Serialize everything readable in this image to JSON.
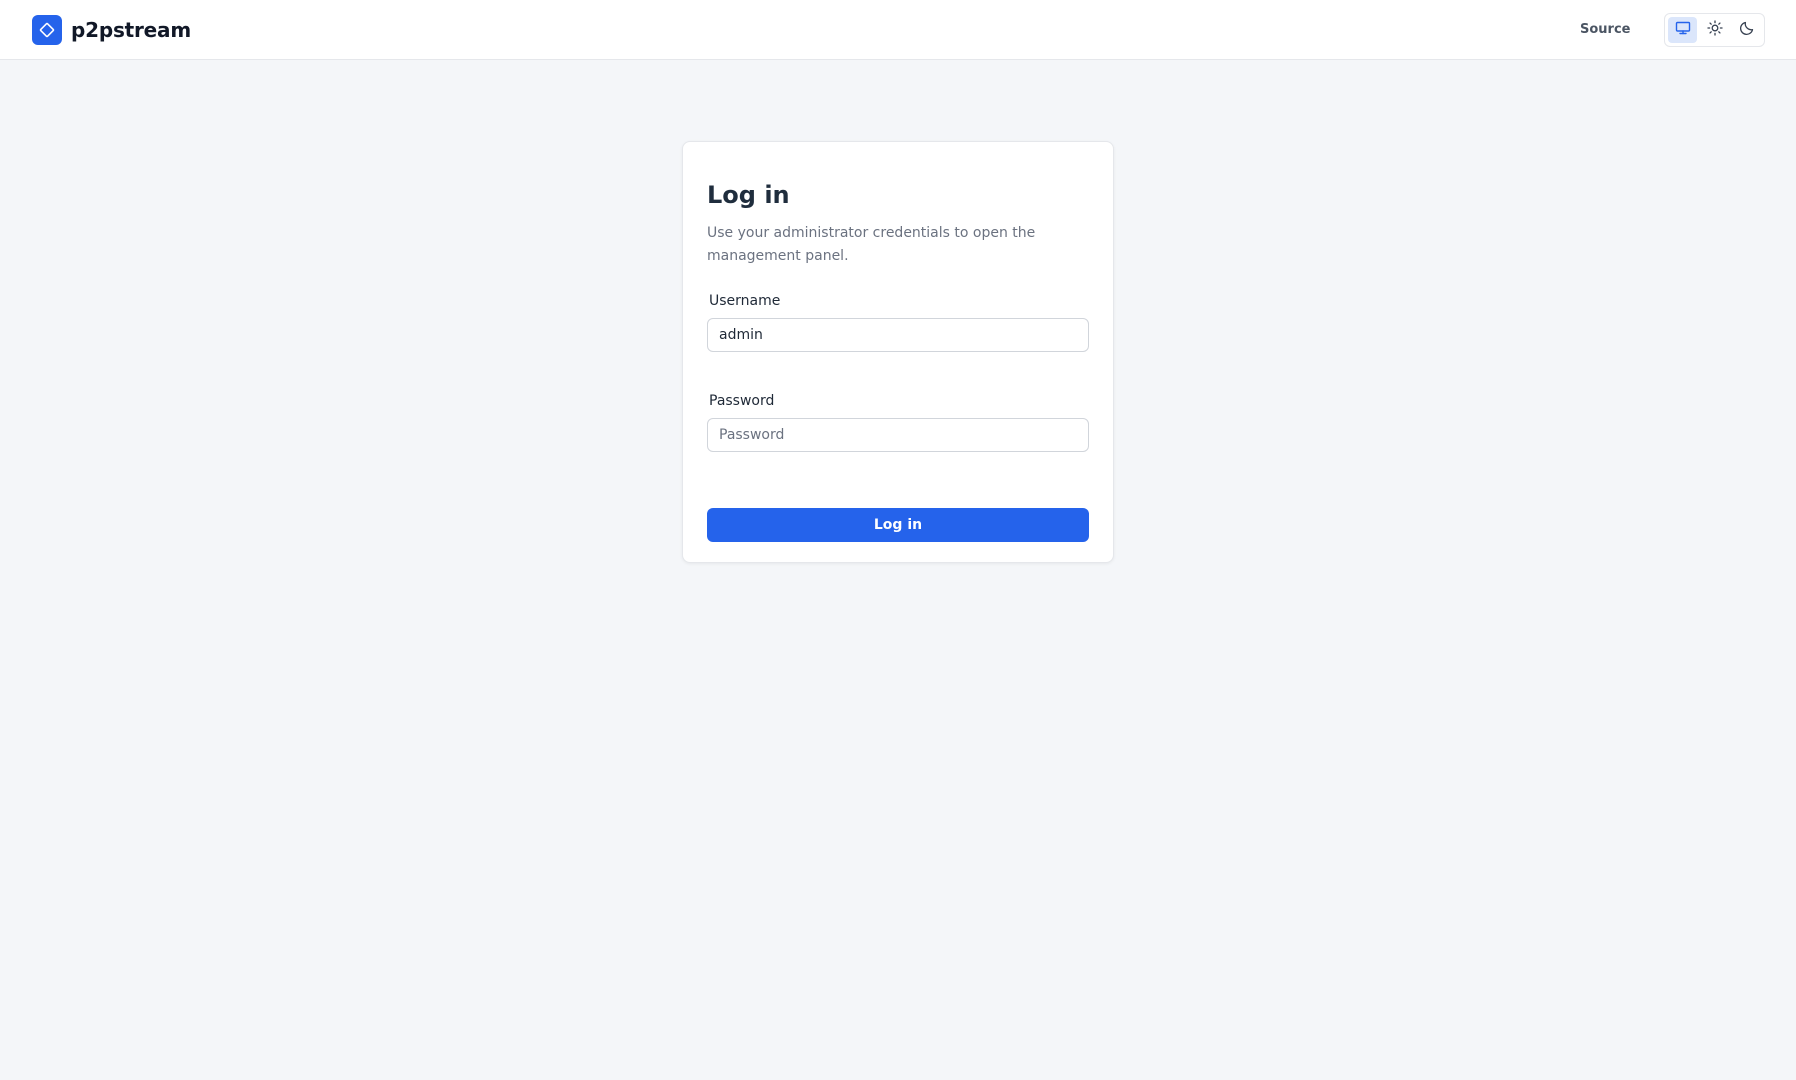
{
  "header": {
    "brand_name": "p2pstream",
    "brand_icon": "diamond-logo-icon",
    "source_label": "Source",
    "theme_options": [
      {
        "name": "system",
        "icon": "monitor-icon",
        "active": true
      },
      {
        "name": "light",
        "icon": "sun-icon",
        "active": false
      },
      {
        "name": "dark",
        "icon": "moon-icon",
        "active": false
      }
    ]
  },
  "login": {
    "title": "Log in",
    "description": "Use your administrator credentials to open the management panel.",
    "username_label": "Username",
    "username_value": "admin",
    "password_label": "Password",
    "password_placeholder": "Password",
    "submit_label": "Log in"
  },
  "colors": {
    "accent": "#2563eb",
    "background": "#f4f6f9",
    "active_toggle": "#dbe6fb"
  }
}
